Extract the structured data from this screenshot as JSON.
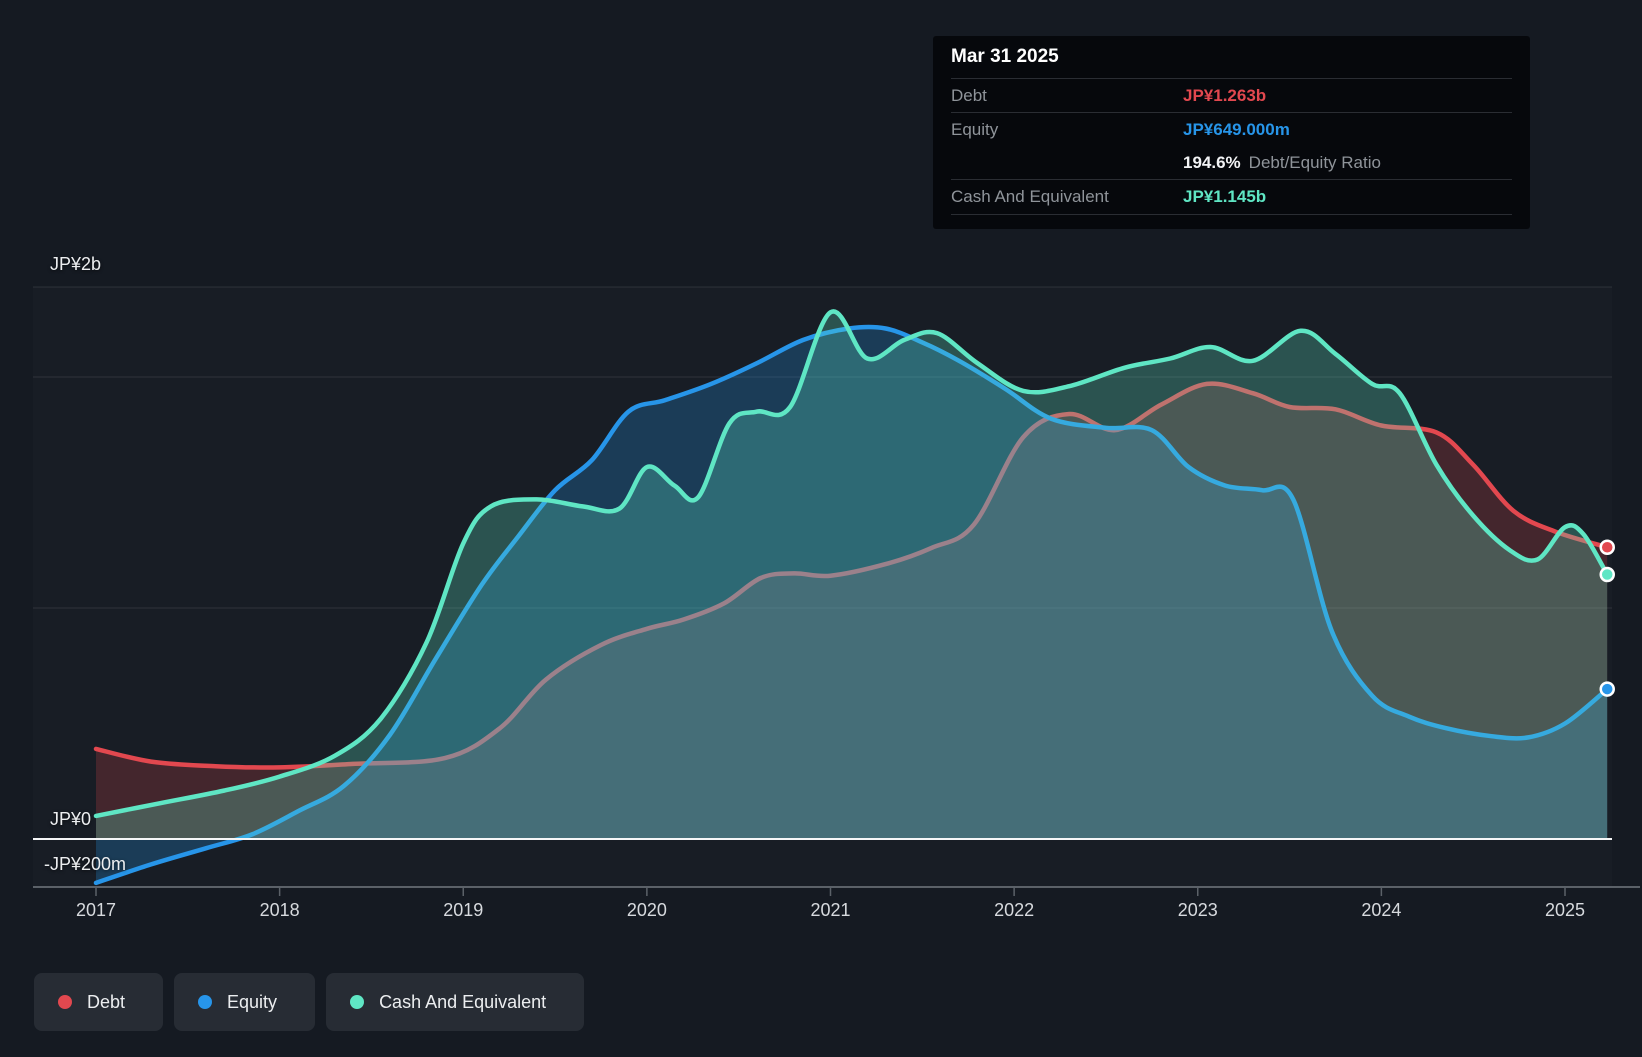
{
  "colors": {
    "background": "#151a22",
    "debt": "#e2484f",
    "equity": "#2795e9",
    "cash": "#5fe6c4",
    "zero_line": "#f5f6f7",
    "gridline": "rgba(255,255,255,0.10)",
    "axis": "#5b6168",
    "x_label": "#d7dade",
    "y_label": "#eceef0"
  },
  "tooltip": {
    "date": "Mar 31 2025",
    "rows": [
      {
        "label": "Debt",
        "value": "JP¥1.263b",
        "color": "#e2484f"
      },
      {
        "label": "Equity",
        "value": "JP¥649.000m",
        "color": "#2795e9"
      }
    ],
    "ratio_value": "194.6%",
    "ratio_label": "Debt/Equity Ratio",
    "cash_row": {
      "label": "Cash And Equivalent",
      "value": "JP¥1.145b",
      "color": "#5fe6c4"
    }
  },
  "legend": {
    "items": [
      {
        "label": "Debt",
        "color": "#e2484f"
      },
      {
        "label": "Equity",
        "color": "#2795e9"
      },
      {
        "label": "Cash And Equivalent",
        "color": "#5fe6c4"
      }
    ]
  },
  "chart_data": {
    "type": "area",
    "unit": "JP¥ billions",
    "x_axis": {
      "ticks": [
        2017,
        2018,
        2019,
        2020,
        2021,
        2022,
        2023,
        2024,
        2025
      ]
    },
    "y_axis": {
      "labels": [
        "JP¥2b",
        "JP¥0",
        "-JP¥200m"
      ],
      "label_values_b": [
        2.0,
        0.0,
        -0.2
      ],
      "ylim_b": [
        -0.21,
        2.39
      ],
      "grid": true
    },
    "legend_position": "bottom-left",
    "series": [
      {
        "name": "Debt",
        "color": "#e2484f",
        "fill_opacity": 0.22,
        "points": [
          [
            2017.0,
            0.39
          ],
          [
            2017.3,
            0.335
          ],
          [
            2017.65,
            0.315
          ],
          [
            2018.0,
            0.31
          ],
          [
            2018.4,
            0.325
          ],
          [
            2018.9,
            0.35
          ],
          [
            2019.2,
            0.48
          ],
          [
            2019.45,
            0.69
          ],
          [
            2019.75,
            0.84
          ],
          [
            2020.0,
            0.91
          ],
          [
            2020.2,
            0.95
          ],
          [
            2020.42,
            1.02
          ],
          [
            2020.62,
            1.13
          ],
          [
            2020.8,
            1.15
          ],
          [
            2021.0,
            1.14
          ],
          [
            2021.3,
            1.19
          ],
          [
            2021.55,
            1.26
          ],
          [
            2021.78,
            1.36
          ],
          [
            2022.05,
            1.74
          ],
          [
            2022.3,
            1.84
          ],
          [
            2022.55,
            1.77
          ],
          [
            2022.8,
            1.88
          ],
          [
            2023.05,
            1.97
          ],
          [
            2023.3,
            1.93
          ],
          [
            2023.5,
            1.87
          ],
          [
            2023.75,
            1.86
          ],
          [
            2024.0,
            1.79
          ],
          [
            2024.3,
            1.76
          ],
          [
            2024.5,
            1.62
          ],
          [
            2024.72,
            1.42
          ],
          [
            2024.95,
            1.33
          ],
          [
            2025.23,
            1.263
          ]
        ]
      },
      {
        "name": "Equity",
        "color": "#2795e9",
        "fill_opacity": 0.26,
        "points": [
          [
            2017.0,
            -0.19
          ],
          [
            2017.3,
            -0.11
          ],
          [
            2017.6,
            -0.04
          ],
          [
            2017.85,
            0.02
          ],
          [
            2018.1,
            0.12
          ],
          [
            2018.35,
            0.23
          ],
          [
            2018.6,
            0.45
          ],
          [
            2018.85,
            0.78
          ],
          [
            2019.1,
            1.1
          ],
          [
            2019.3,
            1.31
          ],
          [
            2019.5,
            1.51
          ],
          [
            2019.7,
            1.64
          ],
          [
            2019.9,
            1.85
          ],
          [
            2020.1,
            1.9
          ],
          [
            2020.35,
            1.97
          ],
          [
            2020.6,
            2.06
          ],
          [
            2020.85,
            2.16
          ],
          [
            2021.1,
            2.21
          ],
          [
            2021.3,
            2.21
          ],
          [
            2021.5,
            2.15
          ],
          [
            2021.7,
            2.07
          ],
          [
            2021.95,
            1.95
          ],
          [
            2022.2,
            1.82
          ],
          [
            2022.5,
            1.78
          ],
          [
            2022.75,
            1.77
          ],
          [
            2022.95,
            1.61
          ],
          [
            2023.15,
            1.53
          ],
          [
            2023.35,
            1.51
          ],
          [
            2023.52,
            1.47
          ],
          [
            2023.73,
            0.9
          ],
          [
            2023.95,
            0.62
          ],
          [
            2024.15,
            0.53
          ],
          [
            2024.35,
            0.48
          ],
          [
            2024.6,
            0.445
          ],
          [
            2024.8,
            0.44
          ],
          [
            2025.0,
            0.5
          ],
          [
            2025.23,
            0.649
          ]
        ]
      },
      {
        "name": "Cash And Equivalent",
        "color": "#5fe6c4",
        "fill_opacity": 0.27,
        "points": [
          [
            2017.0,
            0.1
          ],
          [
            2017.35,
            0.155
          ],
          [
            2017.7,
            0.21
          ],
          [
            2018.0,
            0.27
          ],
          [
            2018.3,
            0.36
          ],
          [
            2018.55,
            0.52
          ],
          [
            2018.8,
            0.85
          ],
          [
            2019.0,
            1.28
          ],
          [
            2019.15,
            1.44
          ],
          [
            2019.4,
            1.47
          ],
          [
            2019.65,
            1.44
          ],
          [
            2019.85,
            1.43
          ],
          [
            2020.0,
            1.61
          ],
          [
            2020.15,
            1.53
          ],
          [
            2020.28,
            1.48
          ],
          [
            2020.45,
            1.8
          ],
          [
            2020.6,
            1.85
          ],
          [
            2020.78,
            1.87
          ],
          [
            2021.0,
            2.28
          ],
          [
            2021.2,
            2.08
          ],
          [
            2021.4,
            2.16
          ],
          [
            2021.58,
            2.19
          ],
          [
            2021.8,
            2.06
          ],
          [
            2022.05,
            1.94
          ],
          [
            2022.3,
            1.96
          ],
          [
            2022.6,
            2.04
          ],
          [
            2022.85,
            2.08
          ],
          [
            2023.07,
            2.13
          ],
          [
            2023.3,
            2.07
          ],
          [
            2023.56,
            2.2
          ],
          [
            2023.75,
            2.1
          ],
          [
            2023.95,
            1.97
          ],
          [
            2024.1,
            1.93
          ],
          [
            2024.3,
            1.62
          ],
          [
            2024.5,
            1.4
          ],
          [
            2024.7,
            1.25
          ],
          [
            2024.85,
            1.21
          ],
          [
            2025.0,
            1.35
          ],
          [
            2025.1,
            1.32
          ],
          [
            2025.23,
            1.145
          ]
        ]
      }
    ],
    "end_values_text": {
      "Debt": "JP¥1.263b",
      "Equity": "JP¥649.000m",
      "Cash And Equivalent": "JP¥1.145b"
    }
  }
}
